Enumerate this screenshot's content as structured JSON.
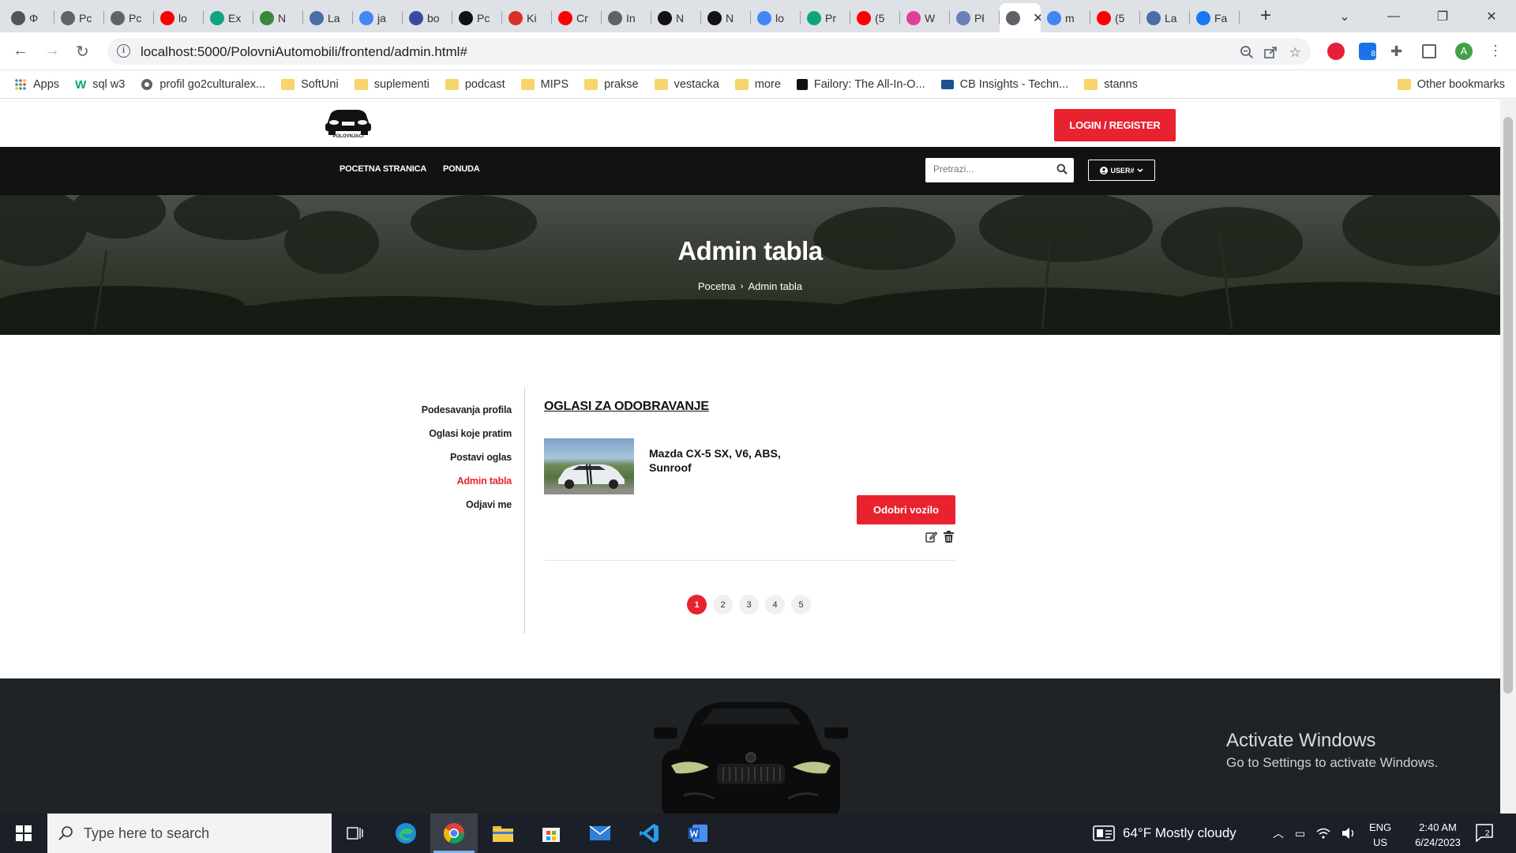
{
  "browser": {
    "tabs": [
      {
        "label": "Φ",
        "icon": "stack-icon",
        "color": "#555555"
      },
      {
        "label": "Pc",
        "icon": "globe-icon",
        "color": "#5f6368"
      },
      {
        "label": "Pc",
        "icon": "globe-icon",
        "color": "#5f6368"
      },
      {
        "label": "lo",
        "icon": "youtube-icon",
        "color": "#ff0000"
      },
      {
        "label": "Ex",
        "icon": "openai-icon",
        "color": "#10a37f"
      },
      {
        "label": "N",
        "icon": "nodejs-icon",
        "color": "#3c873a"
      },
      {
        "label": "La",
        "icon": "book-icon",
        "color": "#4a6fa5"
      },
      {
        "label": "ja",
        "icon": "google-icon",
        "color": "#4285f4"
      },
      {
        "label": "bo",
        "icon": "discord-icon",
        "color": "#3b4aa0"
      },
      {
        "label": "Pc",
        "icon": "github-icon",
        "color": "#111111"
      },
      {
        "label": "Ki",
        "icon": "gmail-icon",
        "color": "#d93025"
      },
      {
        "label": "Cr",
        "icon": "youtube-icon",
        "color": "#ff0000"
      },
      {
        "label": "In",
        "icon": "globe-icon",
        "color": "#5f6368"
      },
      {
        "label": "N",
        "icon": "github-icon",
        "color": "#111111"
      },
      {
        "label": "N",
        "icon": "github-icon",
        "color": "#111111"
      },
      {
        "label": "lo",
        "icon": "google-icon",
        "color": "#4285f4"
      },
      {
        "label": "Pr",
        "icon": "openai-icon",
        "color": "#10a37f"
      },
      {
        "label": "(5",
        "icon": "youtube-icon",
        "color": "#ff0000"
      },
      {
        "label": "W",
        "icon": "app-icon",
        "color": "#e0409a"
      },
      {
        "label": "Pł",
        "icon": "php-icon",
        "color": "#6c7eb7"
      },
      {
        "label": "",
        "icon": "globe-icon",
        "color": "#5f6368",
        "active": true
      },
      {
        "label": "m",
        "icon": "google-icon",
        "color": "#4285f4"
      },
      {
        "label": "(5",
        "icon": "youtube-icon",
        "color": "#ff0000"
      },
      {
        "label": "La",
        "icon": "book-icon",
        "color": "#4a6fa5"
      },
      {
        "label": "Fa",
        "icon": "facebook-icon",
        "color": "#1877f2"
      }
    ],
    "url": "localhost:5000/PolovniAutomobili/frontend/admin.html#",
    "bookmarks": [
      {
        "label": "Apps",
        "icon": "apps-grid-icon"
      },
      {
        "label": "sql w3",
        "icon": "w3-icon"
      },
      {
        "label": "profil go2culturalex...",
        "icon": "globe-icon"
      },
      {
        "label": "SoftUni",
        "icon": "folder-icon"
      },
      {
        "label": "suplementi",
        "icon": "folder-icon"
      },
      {
        "label": "podcast",
        "icon": "folder-icon"
      },
      {
        "label": "MIPS",
        "icon": "folder-icon"
      },
      {
        "label": "prakse",
        "icon": "folder-icon"
      },
      {
        "label": "vestacka",
        "icon": "folder-icon"
      },
      {
        "label": "more",
        "icon": "folder-icon"
      },
      {
        "label": "Failory: The All-In-O...",
        "icon": "failory-icon"
      },
      {
        "label": "CB Insights - Techn...",
        "icon": "cb-icon"
      },
      {
        "label": "stanns",
        "icon": "folder-icon"
      }
    ],
    "other_bookmarks": "Other bookmarks",
    "profile_initial": "A",
    "ext_badge": "8"
  },
  "site": {
    "logo_text": "POLOVNJACI",
    "login_label": "LOGIN / REGISTER",
    "nav": [
      "POCETNA STRANICA",
      "PONUDA"
    ],
    "search_placeholder": "Pretrazi...",
    "user_label": "USER#",
    "hero_title": "Admin tabla",
    "breadcrumb": [
      "Pocetna",
      "Admin tabla"
    ],
    "sidebar": [
      {
        "label": "Podesavanja profila",
        "active": false
      },
      {
        "label": "Oglasi koje pratim",
        "active": false
      },
      {
        "label": "Postavi oglas",
        "active": false
      },
      {
        "label": "Admin tabla",
        "active": true
      },
      {
        "label": "Odjavi me",
        "active": false
      }
    ],
    "section_title": "OGLASI ZA ODOBRAVANJE",
    "listing": {
      "title": "Mazda CX-5 SX, V6, ABS, Sunroof",
      "approve_label": "Odobri vozilo"
    },
    "pagination": [
      "1",
      "2",
      "3",
      "4",
      "5"
    ],
    "current_page": "1",
    "accent_color": "#e8232f"
  },
  "windows": {
    "activate_title": "Activate Windows",
    "activate_sub": "Go to Settings to activate Windows.",
    "search_placeholder": "Type here to search",
    "weather": "64°F  Mostly cloudy",
    "lang_1": "ENG",
    "lang_2": "US",
    "time": "2:40 AM",
    "date": "6/24/2023",
    "notifications": "2"
  }
}
